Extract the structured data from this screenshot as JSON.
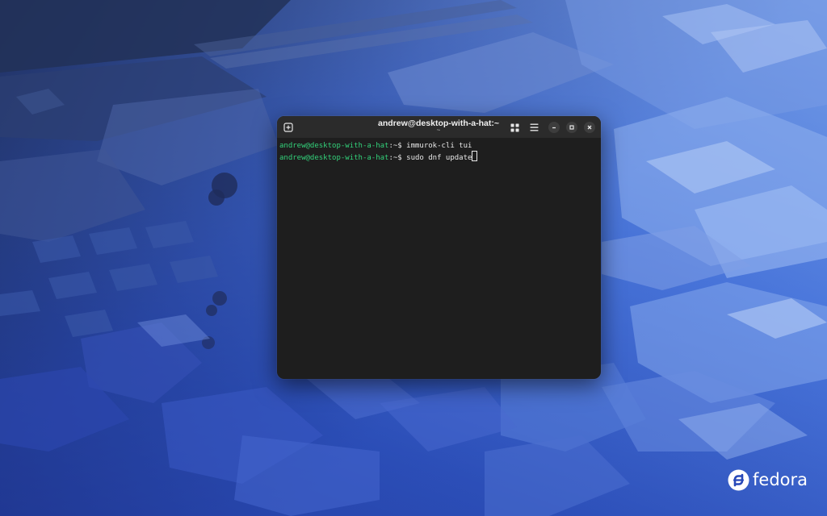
{
  "desktop": {
    "wallpaper": "isometric-city-blue",
    "logo_text": "fedora"
  },
  "terminal": {
    "title": "andrew@desktop-with-a-hat:~",
    "subtitle": "~",
    "buttons": {
      "new_tab_icon": "new-tab-icon",
      "grid_icon": "grid-icon",
      "menu_icon": "hamburger-menu-icon",
      "minimize_icon": "minimize-icon",
      "maximize_icon": "maximize-icon",
      "close_icon": "close-icon"
    },
    "lines": [
      {
        "user_host": "andrew@desktop-with-a-hat",
        "path": ":~$ ",
        "command": "immurok-cli tui"
      },
      {
        "user_host": "andrew@desktop-with-a-hat",
        "path": ":~$ ",
        "command": "sudo dnf update"
      }
    ],
    "colors": {
      "prompt_green": "#33d17a",
      "background": "#1e1e1e",
      "titlebar": "#2b2b2b"
    }
  }
}
